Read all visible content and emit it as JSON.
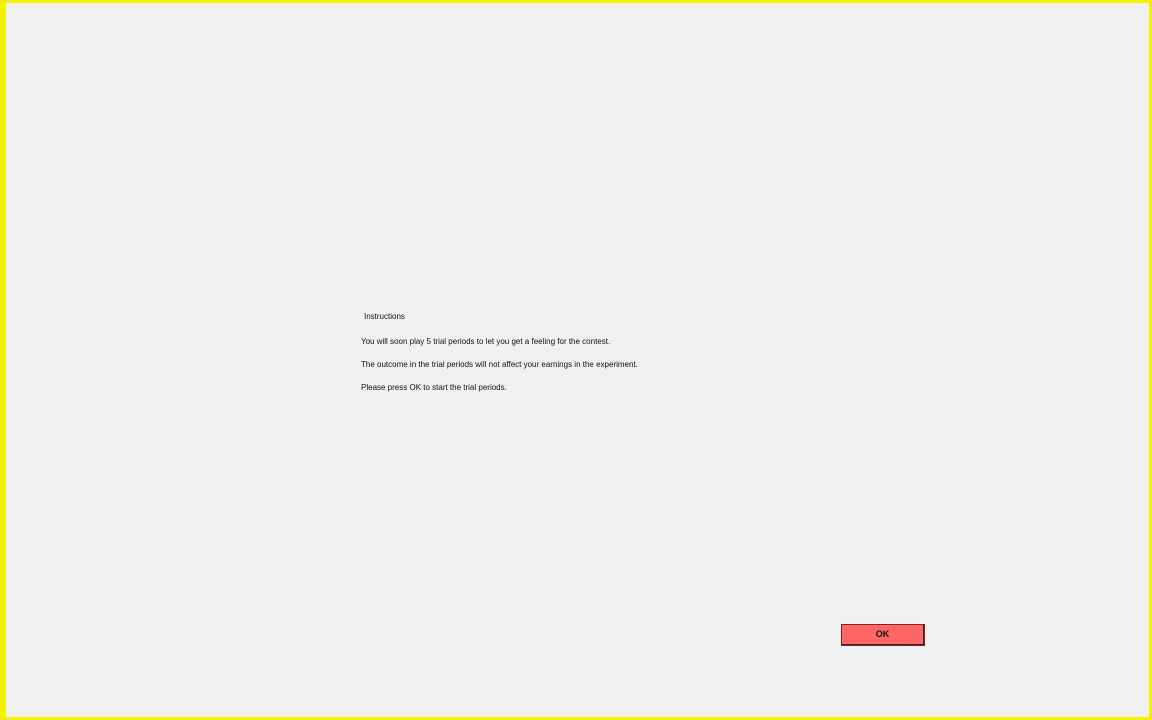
{
  "instructions": {
    "title": "Instructions",
    "lines": [
      "You will soon play 5 trial periods to let you get a feeling for the contest.",
      "The outcome in the trial periods will not affect your earnings in the experiment.",
      "Please press OK to start the trial periods."
    ]
  },
  "actions": {
    "ok_label": "OK"
  },
  "colors": {
    "background": "#f0f0f0",
    "border": "#f2f200",
    "button": "#ff6666"
  }
}
